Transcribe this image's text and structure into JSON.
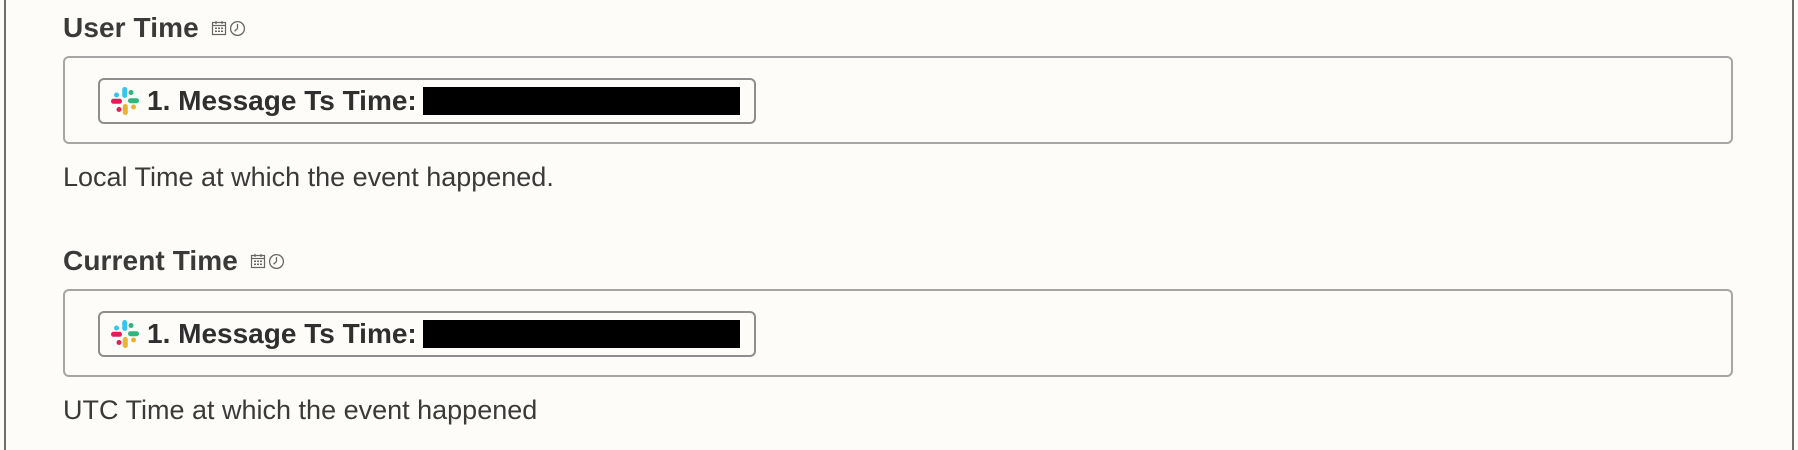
{
  "fields": [
    {
      "label": "User Time",
      "type_icons": [
        "calendar-icon",
        "clock-icon"
      ],
      "token": {
        "app_icon": "slack-icon",
        "text": "1. Message Ts Time:",
        "value_redacted": true
      },
      "help_text": "Local Time at which the event happened."
    },
    {
      "label": "Current Time",
      "type_icons": [
        "calendar-icon",
        "clock-icon"
      ],
      "token": {
        "app_icon": "slack-icon",
        "text": "1. Message Ts Time:",
        "value_redacted": true
      },
      "help_text": "UTC Time at which the event happened"
    }
  ],
  "colors": {
    "background": "#fdfcf8",
    "border": "#a6a6a6",
    "text": "#2b2b2b",
    "slack_blue": "#36c5f0",
    "slack_green": "#2eb67d",
    "slack_yellow": "#ecb22e",
    "slack_red": "#e01e5a"
  }
}
